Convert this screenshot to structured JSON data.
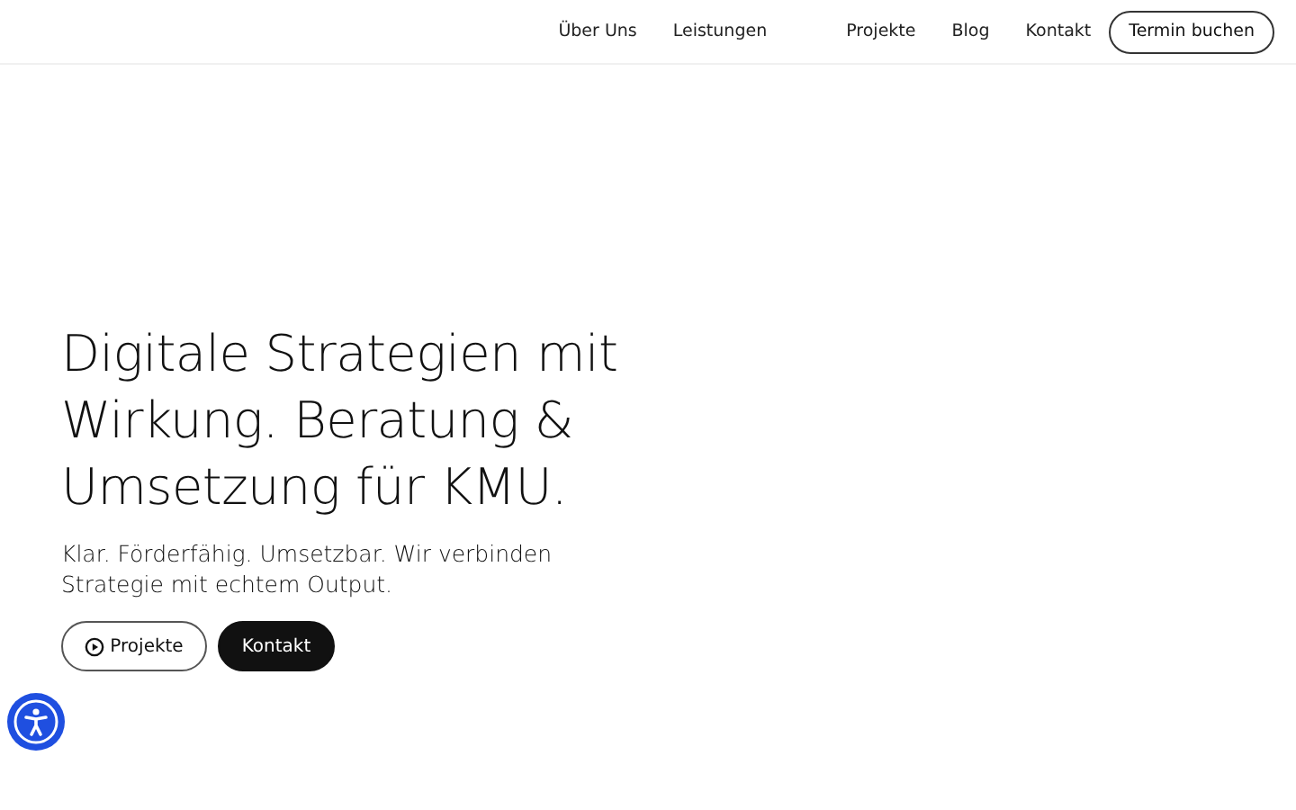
{
  "nav": {
    "links": [
      "Über Uns",
      "Leistungen",
      "Projekte",
      "Blog",
      "Kontakt"
    ],
    "cta": "Termin buchen"
  },
  "hero": {
    "title": "Digitale Strategien mit Wirkung. Beratung & Umsetzung für KMU.",
    "subtitle": "Klar. Förderfähig. Umsetzbar. Wir verbinden Strategie mit echtem Output.",
    "buttons": [
      {
        "kind": "outline",
        "label": "Projekte"
      },
      {
        "kind": "solid",
        "label": "Kontakt"
      }
    ]
  }
}
